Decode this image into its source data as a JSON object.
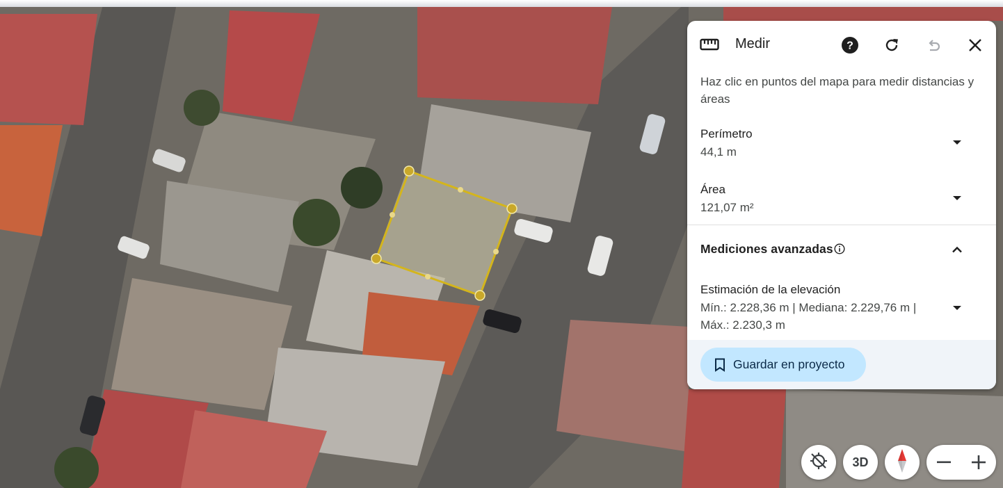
{
  "panel": {
    "title": "Medir",
    "icons": {
      "ruler": "ruler-icon",
      "help": "help-icon",
      "reload": "reload-icon",
      "undo": "undo-icon",
      "close": "close-icon"
    },
    "instructions": "Haz clic en puntos del mapa para medir distancias y áreas",
    "perimeter": {
      "label": "Perímetro",
      "value": "44,1 m"
    },
    "area": {
      "label": "Área",
      "value": "121,07 m²"
    },
    "advanced": {
      "title": "Mediciones avanzadas",
      "elevation": {
        "label": "Estimación de la elevación",
        "value": "Mín.: 2.228,36 m | Mediana: 2.229,76 m | Máx.: 2.230,3 m"
      }
    },
    "save_label": "Guardar en proyecto"
  },
  "controls": {
    "view_3d": "3D",
    "zoom_out": "−",
    "zoom_in": "+"
  },
  "colors": {
    "accent_button": "#c2e7ff",
    "polygon_outline": "#d4b51c",
    "footer_bg": "#f0f4f9"
  }
}
